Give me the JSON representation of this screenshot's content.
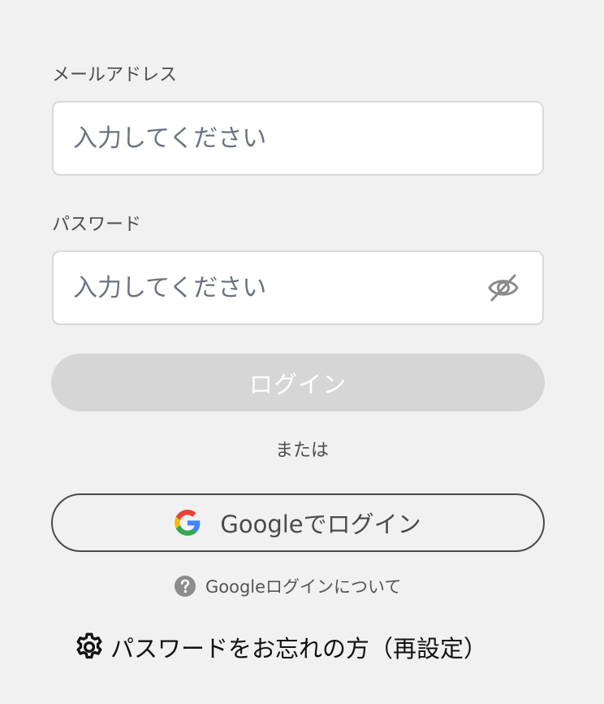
{
  "form": {
    "email": {
      "label": "メールアドレス",
      "placeholder": "入力してください",
      "value": ""
    },
    "password": {
      "label": "パスワード",
      "placeholder": "入力してください",
      "value": "",
      "visibility_icon": "eye-off-icon"
    },
    "login_button": {
      "label": "ログイン",
      "disabled": true
    },
    "separator": "または",
    "google_button": {
      "label": "Googleでログイン",
      "icon": "google-icon"
    },
    "google_about": {
      "label": "Googleログインについて",
      "icon": "help-circle-icon"
    },
    "forgot_password": {
      "label": "パスワードをお忘れの方（再設定）",
      "icon": "gear-icon"
    }
  },
  "colors": {
    "background": "#f1f1f1",
    "field_background": "#ffffff",
    "field_border": "#d9d9d9",
    "login_disabled_bg": "#d6d6d6",
    "text": "#4d4d4d"
  }
}
